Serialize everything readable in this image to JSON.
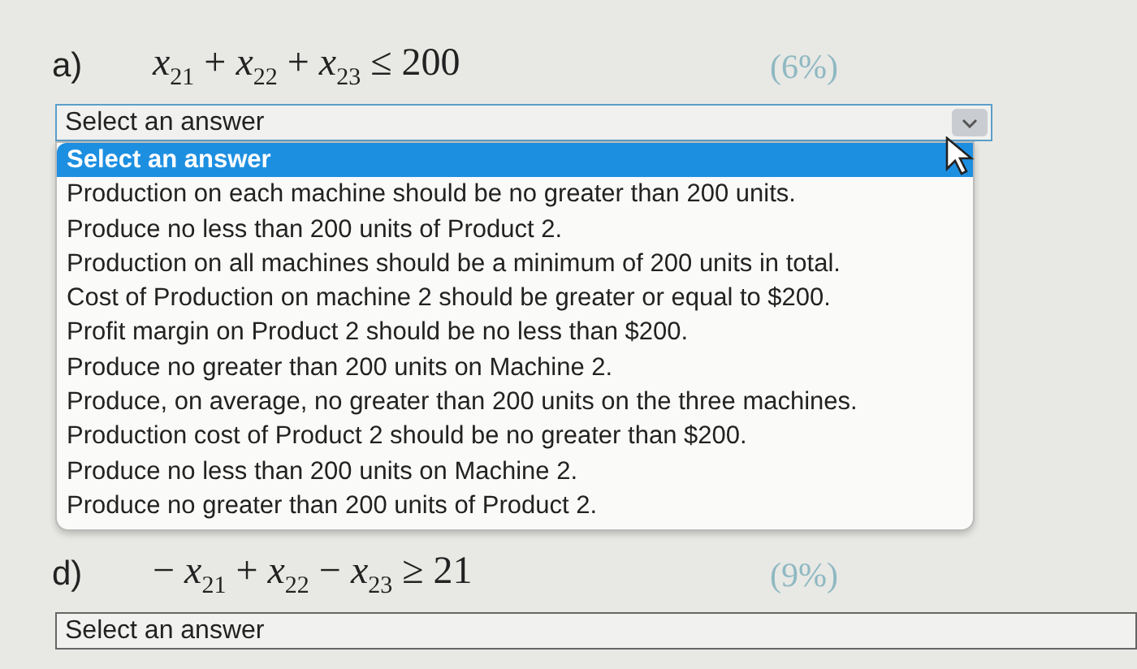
{
  "questions": [
    {
      "label": "a)",
      "expression": "*x*$_{21}$ + *x*$_{22}$ + *x*$_{23}$ ≤ 200",
      "weight": "(6%)",
      "select": {
        "value": "Select an answer",
        "expanded": true,
        "options": [
          {
            "label": "Select an answer",
            "selected": true
          },
          {
            "label": "Production on each machine should be no greater than 200 units.",
            "selected": false
          },
          {
            "label": "Produce no less than 200 units of Product 2.",
            "selected": false
          },
          {
            "label": "Production on all machines should be a minimum of 200 units in total.",
            "selected": false
          },
          {
            "label": "Cost of Production on machine 2 should be greater or equal to $200.",
            "selected": false
          },
          {
            "label": "Profit margin on Product 2 should be no less than $200.",
            "selected": false
          },
          {
            "label": "Produce no greater than 200 units on Machine 2.",
            "selected": false
          },
          {
            "label": "Produce, on average, no greater than 200 units on the three machines.",
            "selected": false
          },
          {
            "label": "Production cost of Product 2 should be no greater than $200.",
            "selected": false
          },
          {
            "label": "Produce no less than 200 units on Machine 2.",
            "selected": false
          },
          {
            "label": "Produce no greater than 200 units of Product 2.",
            "selected": false
          }
        ]
      }
    },
    {
      "label": "d)",
      "expression": "− *x*$_{21}$ + *x*$_{22}$ − *x*$_{23}$ ≥ 21",
      "weight": "(9%)",
      "select": {
        "value": "Select an answer",
        "expanded": false
      }
    }
  ]
}
